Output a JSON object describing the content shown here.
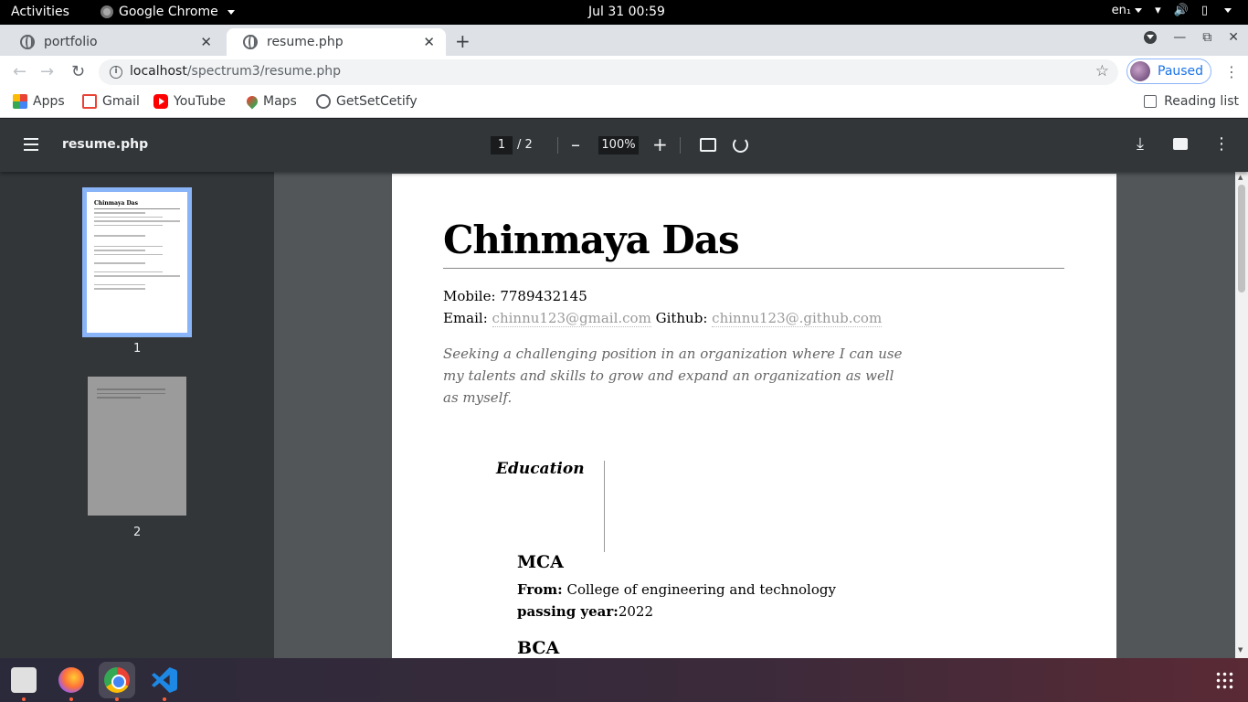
{
  "system": {
    "activities": "Activities",
    "app_name": "Google Chrome",
    "clock": "Jul 31  00:59",
    "lang": "en₁"
  },
  "tabs": [
    {
      "title": "portfolio",
      "active": false
    },
    {
      "title": "resume.php",
      "active": true
    }
  ],
  "omnibox": {
    "host": "localhost",
    "path": "/spectrum3/resume.php"
  },
  "profile": {
    "status": "Paused"
  },
  "bookmarks": [
    {
      "label": "Apps",
      "icon": "apps-grid-icon"
    },
    {
      "label": "Gmail",
      "icon": "gmail-icon"
    },
    {
      "label": "YouTube",
      "icon": "youtube-icon"
    },
    {
      "label": "Maps",
      "icon": "maps-icon"
    },
    {
      "label": "GetSetCetify",
      "icon": "globe-icon"
    }
  ],
  "reading_list": "Reading list",
  "pdf": {
    "title": "resume.php",
    "current_page": "1",
    "total_pages": "/  2",
    "zoom": "100%",
    "thumb_labels": [
      "1",
      "2"
    ],
    "thumb_title": "Chinmaya Das"
  },
  "resume": {
    "name": "Chinmaya Das",
    "mobile_label": "Mobile:",
    "mobile": "7789432145",
    "email_label": "Email:",
    "email": "chinnu123@gmail.com",
    "github_label": "Github:",
    "github": "chinnu123@.github.com",
    "objective": "Seeking a challenging position in an organization where I can use my talents and skills to grow and expand an organization as well as myself.",
    "education_heading": "Education",
    "education": [
      {
        "degree": "MCA",
        "from_label": "From:",
        "from": " College of engineering and technology",
        "year_label": "passing year:",
        "year": "2022"
      },
      {
        "degree": "BCA"
      }
    ]
  },
  "colors": {
    "pdf_toolbar": "#323639",
    "viewer_bg": "#525659",
    "accent": "#8ab4f8"
  }
}
